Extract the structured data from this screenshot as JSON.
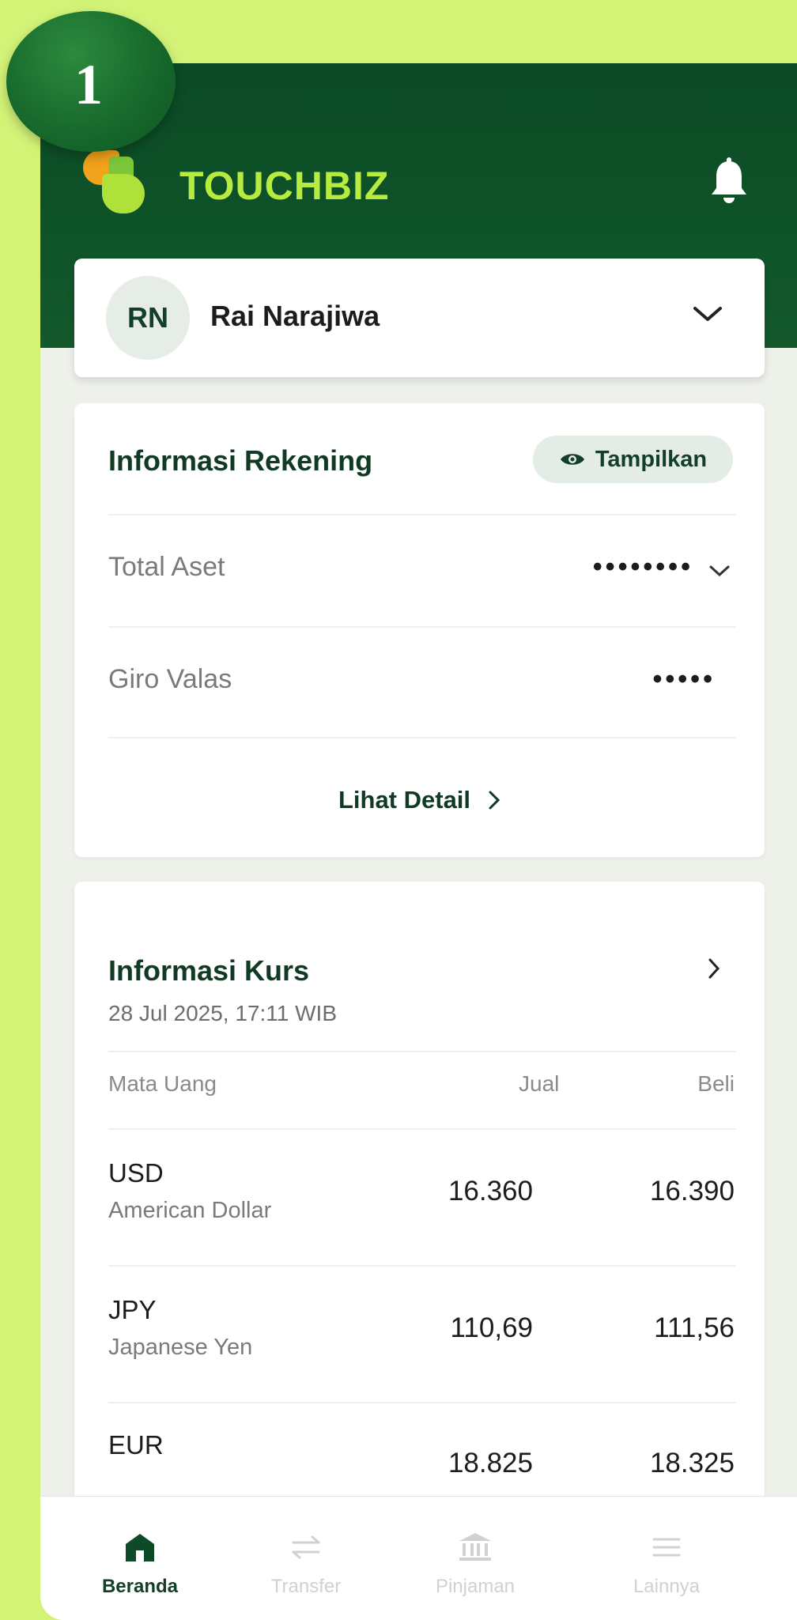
{
  "step_badge": "1",
  "brand": {
    "name": "TOUCHBIZ"
  },
  "user": {
    "initials": "RN",
    "name": "Rai Narajiwa"
  },
  "account_info": {
    "title": "Informasi Rekening",
    "show_label": "Tampilkan",
    "rows": [
      {
        "label": "Total Aset",
        "value": "••••••••"
      },
      {
        "label": "Giro Valas",
        "value": "•••••"
      }
    ],
    "detail_link": "Lihat Detail"
  },
  "exchange": {
    "title": "Informasi Kurs",
    "timestamp": "28 Jul 2025, 17:11 WIB",
    "headers": {
      "currency": "Mata Uang",
      "sell": "Jual",
      "buy": "Beli"
    },
    "rows": [
      {
        "code": "USD",
        "name": "American Dollar",
        "sell": "16.360",
        "buy": "16.390"
      },
      {
        "code": "JPY",
        "name": "Japanese Yen",
        "sell": "110,69",
        "buy": "111,56"
      },
      {
        "code": "EUR",
        "name": "",
        "sell": "18.825",
        "buy": "18.325"
      }
    ]
  },
  "nav": [
    {
      "label": "Beranda",
      "icon": "home-icon",
      "active": true
    },
    {
      "label": "Transfer",
      "icon": "transfer-icon",
      "active": false
    },
    {
      "label": "Pinjaman",
      "icon": "bank-icon",
      "active": false
    },
    {
      "label": "Lainnya",
      "icon": "menu-icon",
      "active": false
    }
  ],
  "colors": {
    "accent": "#0e5228",
    "brand_text": "#b6ec3f",
    "background": "#d3f377"
  }
}
